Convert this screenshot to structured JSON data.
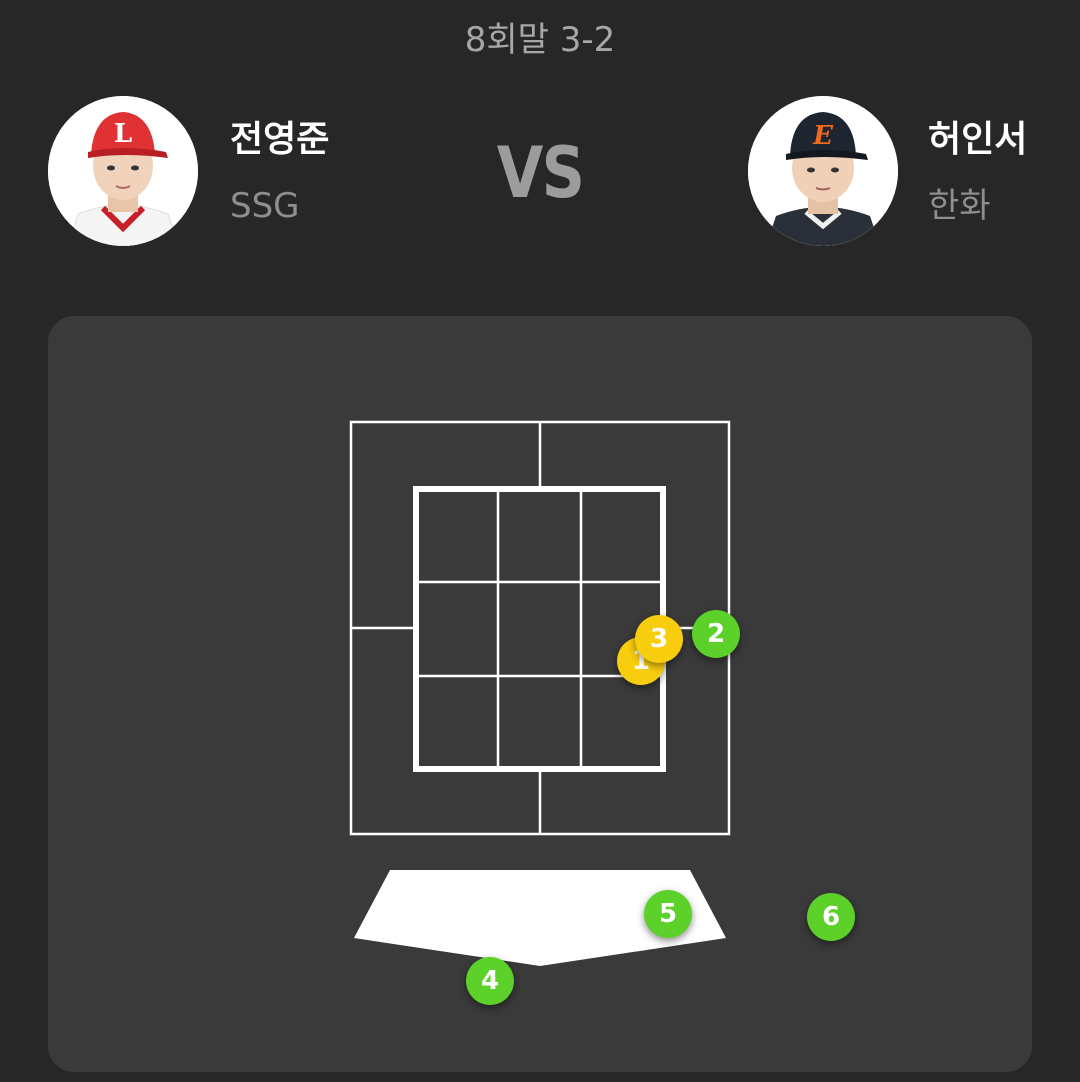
{
  "game": {
    "inning_score": "8회말 3-2",
    "vs_label": "VS"
  },
  "pitcher": {
    "name": "전영준",
    "team": "SSG",
    "cap_color": "#e03134",
    "cap_logo": "L"
  },
  "batter": {
    "name": "허인서",
    "team": "한화",
    "cap_color": "#1e2430",
    "cap_logo": "E"
  },
  "colors": {
    "background": "#272727",
    "panel": "#3a3a3a",
    "strike_zone_lines": "#ffffff",
    "ball_marker": "#5bd12a",
    "strike_marker": "#f7cd0e"
  },
  "pitches": [
    {
      "number": "1",
      "result": "strike",
      "color": "yellow"
    },
    {
      "number": "2",
      "result": "ball",
      "color": "green"
    },
    {
      "number": "3",
      "result": "strike",
      "color": "yellow"
    },
    {
      "number": "4",
      "result": "ball",
      "color": "green"
    },
    {
      "number": "5",
      "result": "ball",
      "color": "green"
    },
    {
      "number": "6",
      "result": "ball",
      "color": "green"
    }
  ]
}
